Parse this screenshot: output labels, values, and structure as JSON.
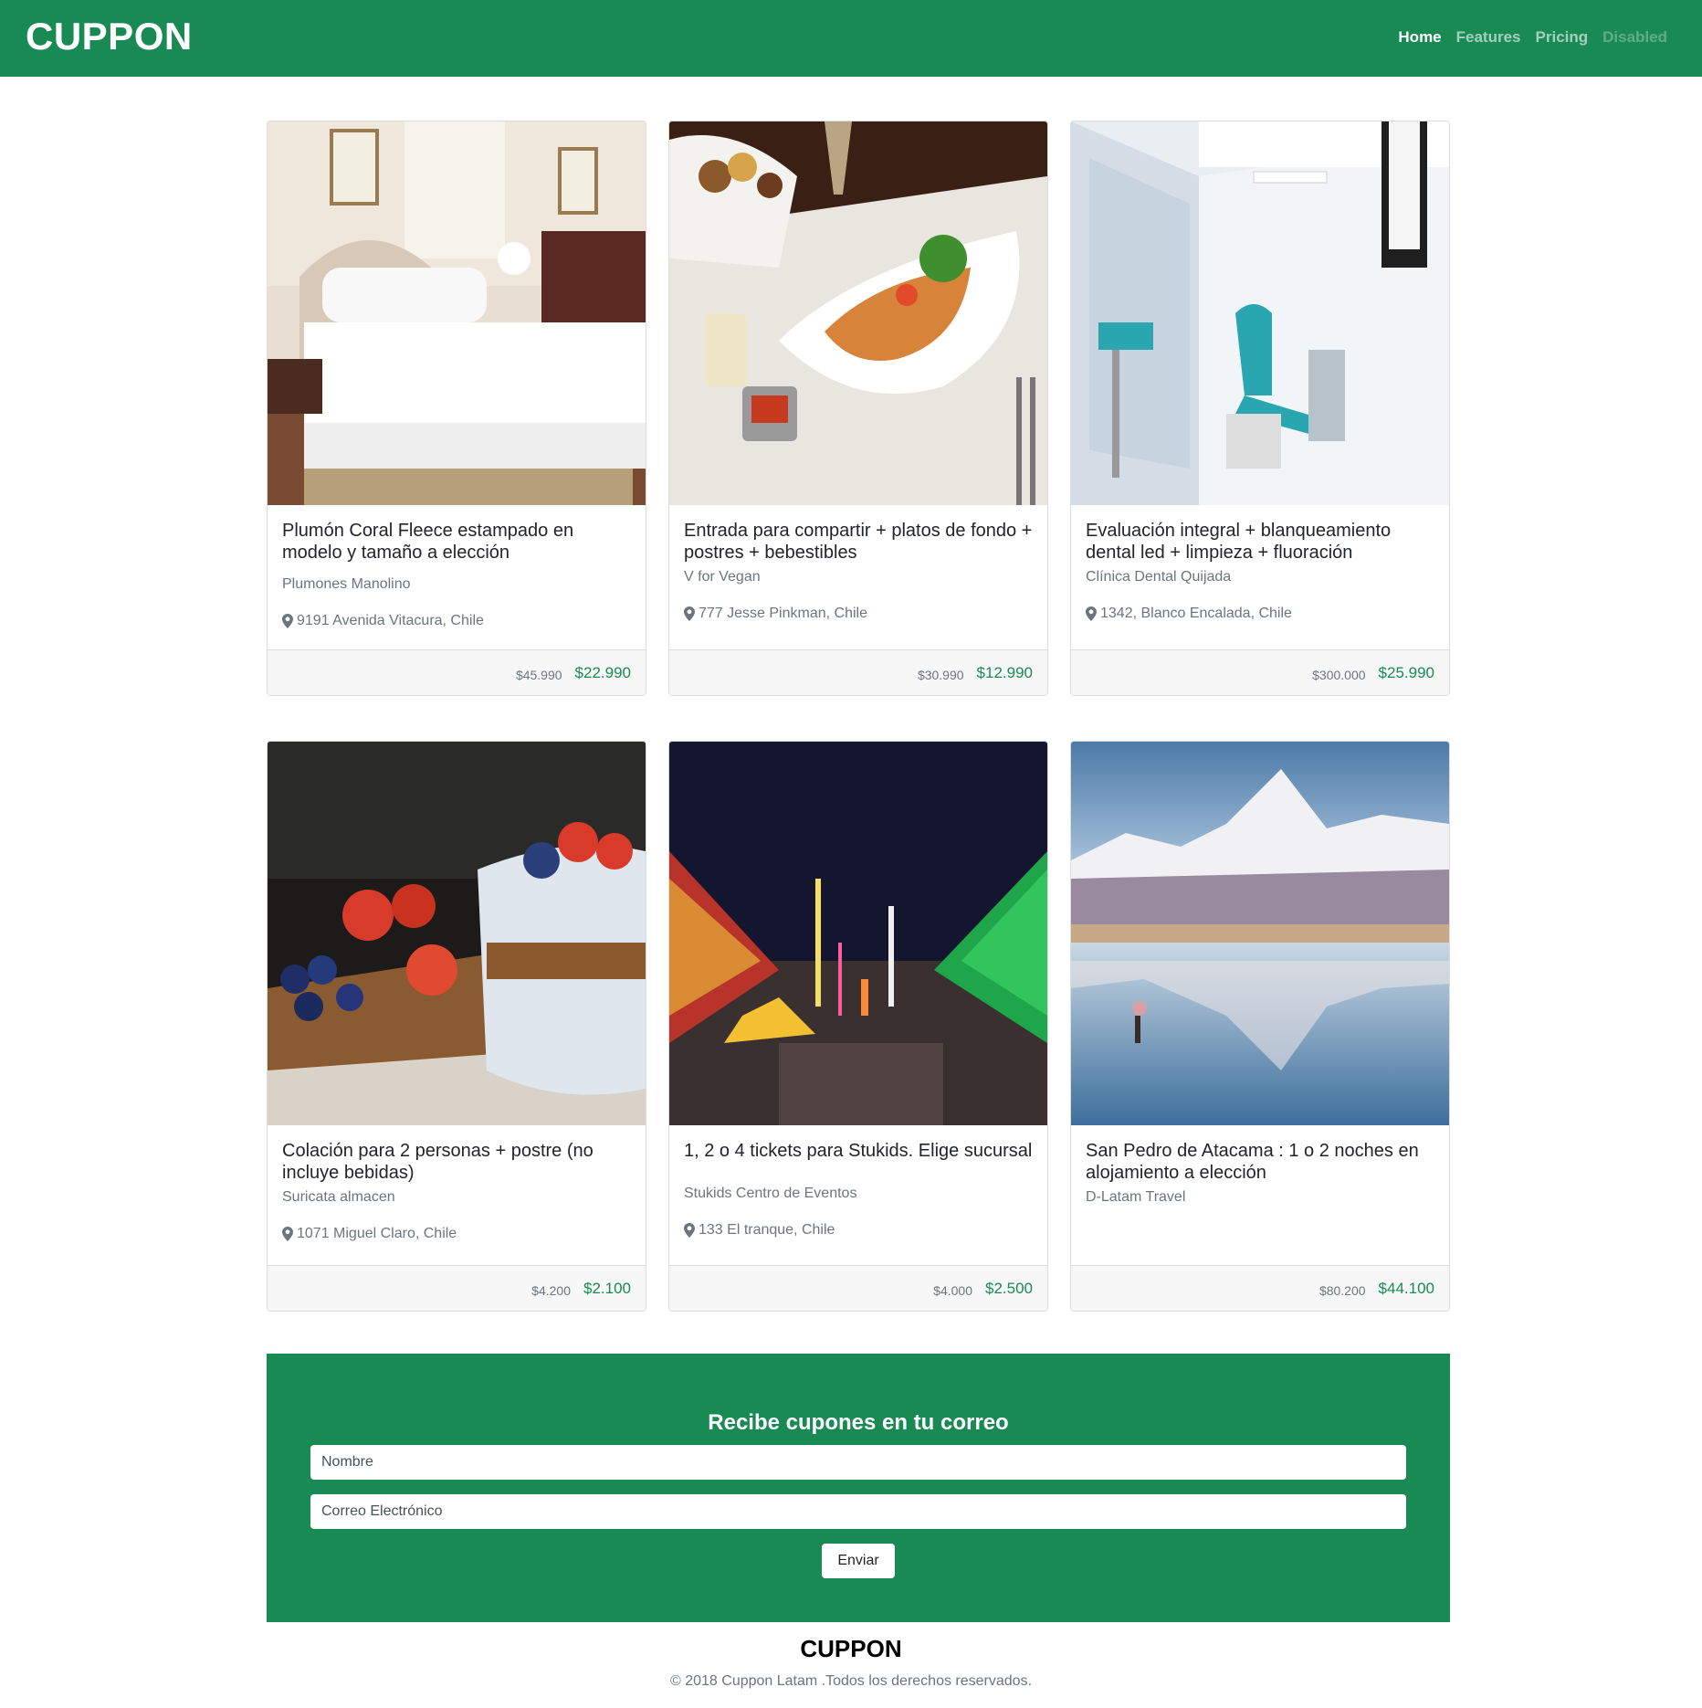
{
  "navbar": {
    "brand": "CUPPON",
    "links": [
      {
        "label": "Home",
        "state": "active"
      },
      {
        "label": "Features",
        "state": "normal"
      },
      {
        "label": "Pricing",
        "state": "normal"
      },
      {
        "label": "Disabled",
        "state": "disabled"
      }
    ]
  },
  "deals": [
    {
      "title": "Plumón Coral Fleece estampado en modelo y tamaño a elección",
      "merchant": "Plumones Manolino",
      "address": "9191 Avenida Vitacura, Chile",
      "price_old": "$45.990",
      "price_new": "$22.990",
      "image": "bedroom"
    },
    {
      "title": "Entrada para compartir + platos de fondo + postres + bebestibles",
      "merchant": "V for Vegan",
      "address": "777 Jesse Pinkman, Chile",
      "price_old": "$30.990",
      "price_new": "$12.990",
      "image": "restaurant-dish"
    },
    {
      "title": "Evaluación integral + blanqueamiento dental led + limpieza + fluoración",
      "merchant": "Clínica Dental Quijada",
      "address": "1342, Blanco Encalada, Chile",
      "price_old": "$300.000",
      "price_new": "$25.990",
      "image": "dental-clinic"
    },
    {
      "title": "Colación para 2 personas + postre (no incluye bebidas)",
      "merchant": "Suricata almacen",
      "address": "1071 Miguel Claro, Chile",
      "price_old": "$4.200",
      "price_new": "$2.100",
      "image": "yogurt-berries"
    },
    {
      "title": "1, 2 o 4 tickets para Stukids. Elige sucursal",
      "merchant": "Stukids Centro de Eventos",
      "address": "133 El tranque, Chile",
      "price_old": "$4.000",
      "price_new": "$2.500",
      "image": "night-fair"
    },
    {
      "title": "San Pedro de Atacama : 1 o 2 noches en alojamiento a elección",
      "merchant": "D-Latam Travel",
      "address": "",
      "price_old": "$80.200",
      "price_new": "$44.100",
      "image": "atacama-lagoon"
    }
  ],
  "subscribe": {
    "title": "Recibe cupones en tu correo",
    "name_placeholder": "Nombre",
    "email_placeholder": "Correo Electrónico",
    "button_label": "Enviar"
  },
  "footer": {
    "brand": "CUPPON",
    "copyright": "© 2018 Cuppon Latam .Todos los derechos reservados."
  }
}
